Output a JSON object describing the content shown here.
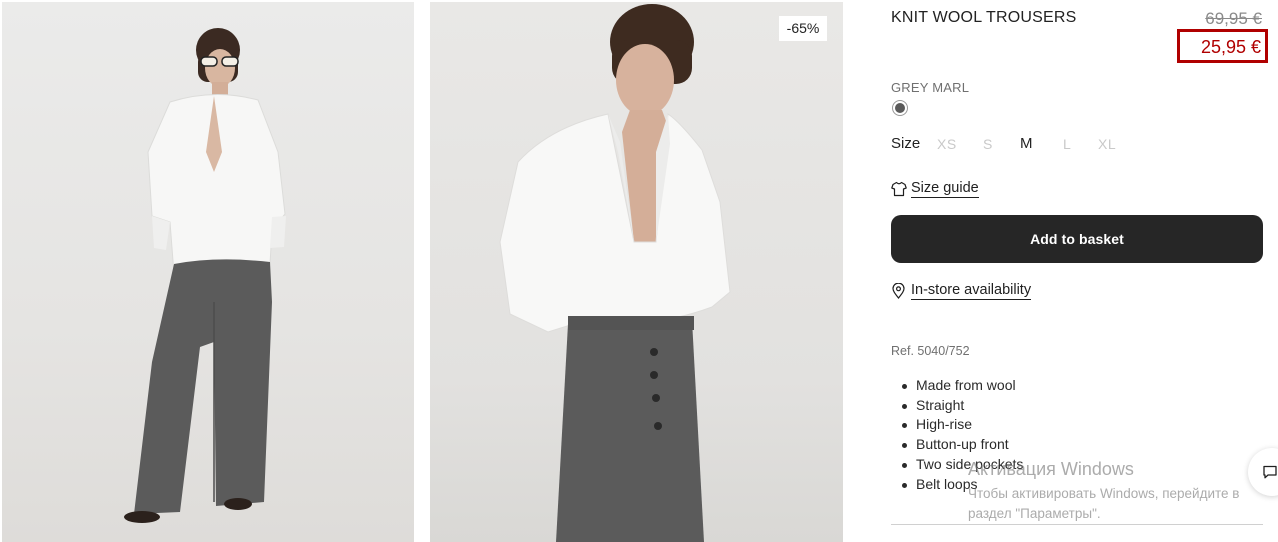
{
  "product": {
    "title": "KNIT WOOL TROUSERS",
    "price_original": "69,95 €",
    "price_sale": "25,95 €",
    "discount_badge": "-65%",
    "color_name": "GREY MARL",
    "color_hex": "#5a5a5a",
    "size_label": "Size",
    "sizes": [
      {
        "label": "XS",
        "available": false
      },
      {
        "label": "S",
        "available": false
      },
      {
        "label": "M",
        "available": true
      },
      {
        "label": "L",
        "available": false
      },
      {
        "label": "XL",
        "available": false
      }
    ],
    "size_guide_label": "Size guide",
    "add_to_basket_label": "Add to basket",
    "store_availability_label": "In-store availability",
    "reference": "Ref. 5040/752",
    "features": [
      "Made from wool",
      "Straight",
      "High-rise",
      "Button-up front",
      "Two side pockets",
      "Belt loops"
    ]
  },
  "colors": {
    "sale_red": "#b00000",
    "button_dark": "#262626",
    "trouser_grey": "#5b5b5b"
  },
  "windows_watermark": {
    "title": "Активация Windows",
    "text": "Чтобы активировать Windows, перейдите в раздел \"Параметры\"."
  }
}
